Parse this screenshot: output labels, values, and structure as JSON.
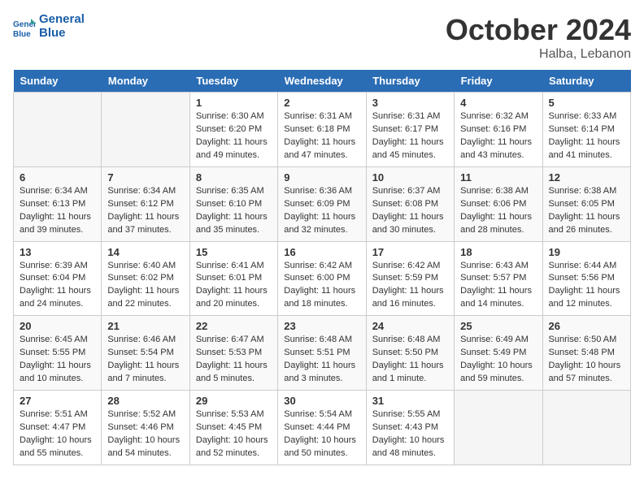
{
  "header": {
    "logo_line1": "General",
    "logo_line2": "Blue",
    "month": "October 2024",
    "location": "Halba, Lebanon"
  },
  "weekdays": [
    "Sunday",
    "Monday",
    "Tuesday",
    "Wednesday",
    "Thursday",
    "Friday",
    "Saturday"
  ],
  "weeks": [
    [
      {
        "day": "",
        "empty": true
      },
      {
        "day": "",
        "empty": true
      },
      {
        "day": "1",
        "sunrise": "6:30 AM",
        "sunset": "6:20 PM",
        "daylight": "11 hours and 49 minutes."
      },
      {
        "day": "2",
        "sunrise": "6:31 AM",
        "sunset": "6:18 PM",
        "daylight": "11 hours and 47 minutes."
      },
      {
        "day": "3",
        "sunrise": "6:31 AM",
        "sunset": "6:17 PM",
        "daylight": "11 hours and 45 minutes."
      },
      {
        "day": "4",
        "sunrise": "6:32 AM",
        "sunset": "6:16 PM",
        "daylight": "11 hours and 43 minutes."
      },
      {
        "day": "5",
        "sunrise": "6:33 AM",
        "sunset": "6:14 PM",
        "daylight": "11 hours and 41 minutes."
      }
    ],
    [
      {
        "day": "6",
        "sunrise": "6:34 AM",
        "sunset": "6:13 PM",
        "daylight": "11 hours and 39 minutes."
      },
      {
        "day": "7",
        "sunrise": "6:34 AM",
        "sunset": "6:12 PM",
        "daylight": "11 hours and 37 minutes."
      },
      {
        "day": "8",
        "sunrise": "6:35 AM",
        "sunset": "6:10 PM",
        "daylight": "11 hours and 35 minutes."
      },
      {
        "day": "9",
        "sunrise": "6:36 AM",
        "sunset": "6:09 PM",
        "daylight": "11 hours and 32 minutes."
      },
      {
        "day": "10",
        "sunrise": "6:37 AM",
        "sunset": "6:08 PM",
        "daylight": "11 hours and 30 minutes."
      },
      {
        "day": "11",
        "sunrise": "6:38 AM",
        "sunset": "6:06 PM",
        "daylight": "11 hours and 28 minutes."
      },
      {
        "day": "12",
        "sunrise": "6:38 AM",
        "sunset": "6:05 PM",
        "daylight": "11 hours and 26 minutes."
      }
    ],
    [
      {
        "day": "13",
        "sunrise": "6:39 AM",
        "sunset": "6:04 PM",
        "daylight": "11 hours and 24 minutes."
      },
      {
        "day": "14",
        "sunrise": "6:40 AM",
        "sunset": "6:02 PM",
        "daylight": "11 hours and 22 minutes."
      },
      {
        "day": "15",
        "sunrise": "6:41 AM",
        "sunset": "6:01 PM",
        "daylight": "11 hours and 20 minutes."
      },
      {
        "day": "16",
        "sunrise": "6:42 AM",
        "sunset": "6:00 PM",
        "daylight": "11 hours and 18 minutes."
      },
      {
        "day": "17",
        "sunrise": "6:42 AM",
        "sunset": "5:59 PM",
        "daylight": "11 hours and 16 minutes."
      },
      {
        "day": "18",
        "sunrise": "6:43 AM",
        "sunset": "5:57 PM",
        "daylight": "11 hours and 14 minutes."
      },
      {
        "day": "19",
        "sunrise": "6:44 AM",
        "sunset": "5:56 PM",
        "daylight": "11 hours and 12 minutes."
      }
    ],
    [
      {
        "day": "20",
        "sunrise": "6:45 AM",
        "sunset": "5:55 PM",
        "daylight": "11 hours and 10 minutes."
      },
      {
        "day": "21",
        "sunrise": "6:46 AM",
        "sunset": "5:54 PM",
        "daylight": "11 hours and 7 minutes."
      },
      {
        "day": "22",
        "sunrise": "6:47 AM",
        "sunset": "5:53 PM",
        "daylight": "11 hours and 5 minutes."
      },
      {
        "day": "23",
        "sunrise": "6:48 AM",
        "sunset": "5:51 PM",
        "daylight": "11 hours and 3 minutes."
      },
      {
        "day": "24",
        "sunrise": "6:48 AM",
        "sunset": "5:50 PM",
        "daylight": "11 hours and 1 minute."
      },
      {
        "day": "25",
        "sunrise": "6:49 AM",
        "sunset": "5:49 PM",
        "daylight": "10 hours and 59 minutes."
      },
      {
        "day": "26",
        "sunrise": "6:50 AM",
        "sunset": "5:48 PM",
        "daylight": "10 hours and 57 minutes."
      }
    ],
    [
      {
        "day": "27",
        "sunrise": "5:51 AM",
        "sunset": "4:47 PM",
        "daylight": "10 hours and 55 minutes."
      },
      {
        "day": "28",
        "sunrise": "5:52 AM",
        "sunset": "4:46 PM",
        "daylight": "10 hours and 54 minutes."
      },
      {
        "day": "29",
        "sunrise": "5:53 AM",
        "sunset": "4:45 PM",
        "daylight": "10 hours and 52 minutes."
      },
      {
        "day": "30",
        "sunrise": "5:54 AM",
        "sunset": "4:44 PM",
        "daylight": "10 hours and 50 minutes."
      },
      {
        "day": "31",
        "sunrise": "5:55 AM",
        "sunset": "4:43 PM",
        "daylight": "10 hours and 48 minutes."
      },
      {
        "day": "",
        "empty": true
      },
      {
        "day": "",
        "empty": true
      }
    ]
  ]
}
